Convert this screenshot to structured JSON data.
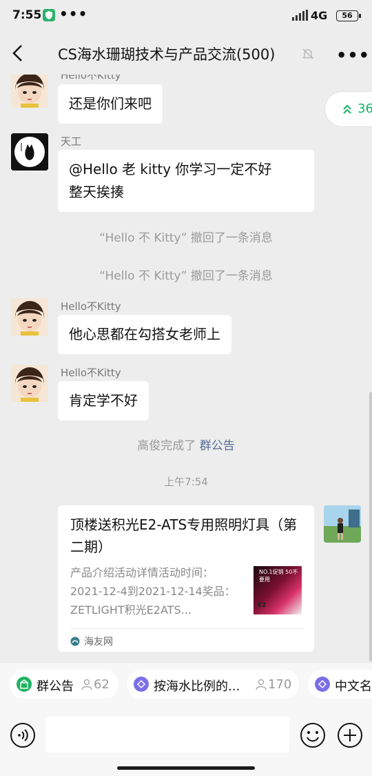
{
  "status_bar": {
    "time": "7:55",
    "more": "•••",
    "network": "4G",
    "battery": "56"
  },
  "header": {
    "title": "CS海水珊瑚技术与产品交流(500)",
    "more": "•••"
  },
  "scroll_badge": {
    "count": "36"
  },
  "messages": [
    {
      "sender": "Hello不Kitty",
      "text": "还是你们来吧"
    },
    {
      "sender": "天工",
      "line1": "@Hello 老 kitty   你学习一定不好",
      "line2": "整天挨揍"
    },
    {
      "system": "“Hello 不 Kitty” 撤回了一条消息"
    },
    {
      "system": "“Hello 不 Kitty” 撤回了一条消息"
    },
    {
      "sender": "Hello不Kitty",
      "text": "他心思都在勾搭女老师上"
    },
    {
      "sender": "Hello不Kitty",
      "text": "肯定学不好"
    },
    {
      "system_prefix": "高俊完成了",
      "system_link": "群公告"
    },
    {
      "timestamp": "上午7:54"
    }
  ],
  "link_card": {
    "title": "顶楼送积光E2-ATS专用照明灯具（第二期）",
    "description": "产品介绍活动详情活动时间：2021-12-4到2021-12-14奖品：ZETLIGHT积光E2ATS...",
    "thumbnail_top": "NO.1促销 50不要用",
    "thumbnail_bottom": "E2",
    "source": "海友网"
  },
  "group_tools": [
    {
      "label": "群公告",
      "count": "62",
      "icon": "announcement-icon",
      "color": "#1fb463"
    },
    {
      "label": "按海水比例的...",
      "count": "170",
      "icon": "document-icon",
      "color": "#7b6fe8"
    },
    {
      "label": "中文名",
      "icon": "document-icon",
      "color": "#7b6fe8"
    }
  ],
  "input": {
    "placeholder": ""
  },
  "colors": {
    "accent_green": "#13b465",
    "link_blue": "#576b95",
    "background": "#ededed"
  }
}
